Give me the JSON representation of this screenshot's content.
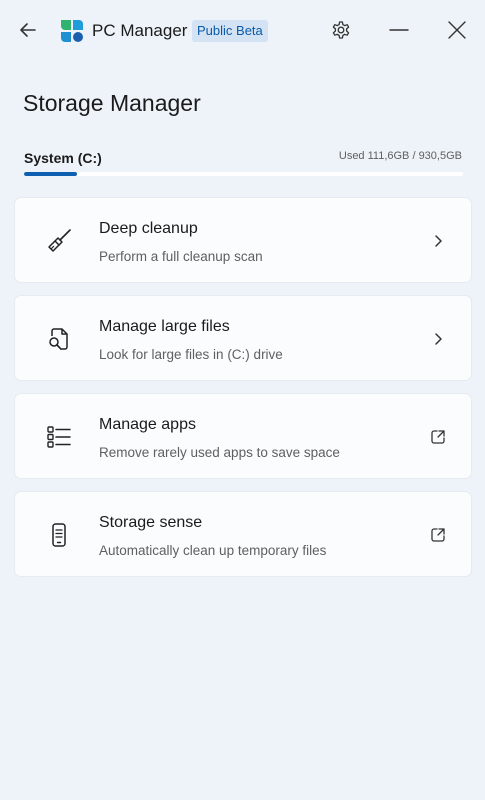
{
  "window": {
    "app_title": "PC Manager",
    "badge": "Public Beta",
    "buttons": {
      "back": "arrow-left-icon",
      "settings": "gear-icon",
      "minimize": "minimize-icon",
      "close": "close-icon"
    }
  },
  "page": {
    "title": "Storage Manager"
  },
  "drive": {
    "name": "System (C:)",
    "usage_text": "Used 111,6GB / 930,5GB",
    "used_fraction": 0.12,
    "accent_color": "#0f5fb0"
  },
  "cards": [
    {
      "title": "Deep cleanup",
      "subtitle": "Perform a full cleanup scan",
      "icon": "broom-icon",
      "action_icon": "chevron-right-icon"
    },
    {
      "title": "Manage large files",
      "subtitle": "Look for large files in (C:) drive",
      "icon": "file-search-icon",
      "action_icon": "chevron-right-icon"
    },
    {
      "title": "Manage apps",
      "subtitle": "Remove rarely used apps to save space",
      "icon": "app-list-icon",
      "action_icon": "open-external-icon"
    },
    {
      "title": "Storage sense",
      "subtitle": "Automatically clean up temporary files",
      "icon": "phone-storage-icon",
      "action_icon": "open-external-icon"
    }
  ]
}
